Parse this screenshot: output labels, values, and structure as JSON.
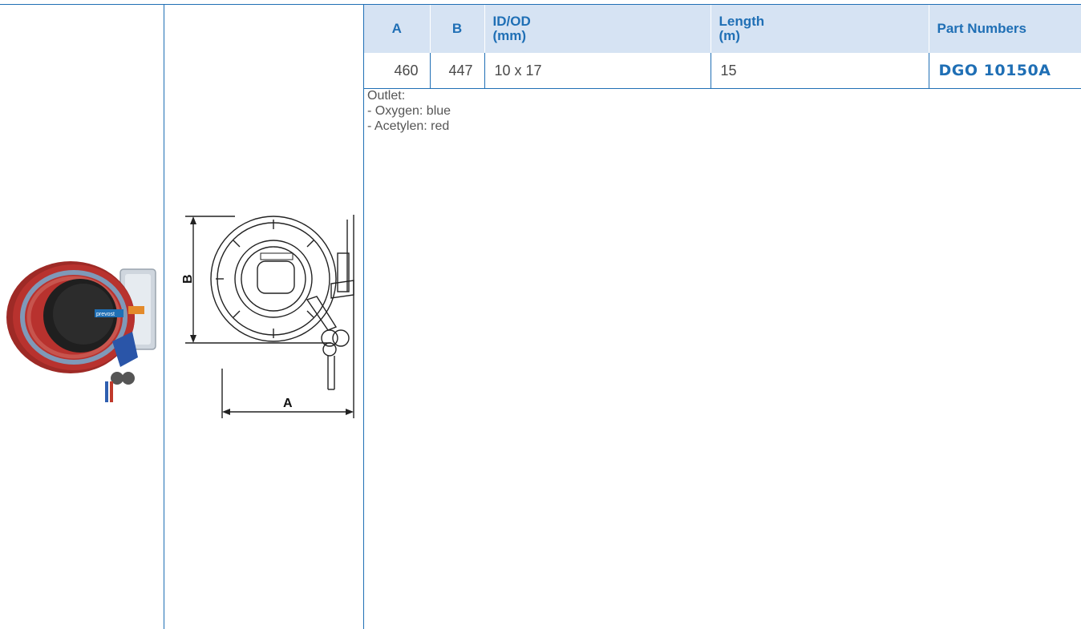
{
  "table": {
    "headers": {
      "a": "A",
      "b": "B",
      "idod_line1": "ID/OD",
      "idod_line2": "(mm)",
      "length_line1": "Length",
      "length_line2": "(m)",
      "part_numbers": "Part Numbers"
    },
    "rows": [
      {
        "a": "460",
        "b": "447",
        "idod": "10 x 17",
        "length": "15",
        "part_number": "DGO 10150A"
      }
    ]
  },
  "notes": {
    "title": "Outlet:",
    "lines": [
      "- Oxygen: blue",
      "- Acetylen: red"
    ]
  },
  "drawing": {
    "dim_a": "A",
    "dim_b": "B",
    "badge_text": "prevost"
  },
  "colors": {
    "accent_blue": "#1f6fb5",
    "header_bg": "#d6e3f3",
    "reel_red": "#b8322e"
  }
}
